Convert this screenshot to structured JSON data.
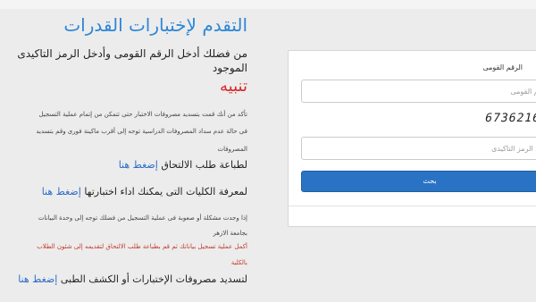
{
  "page": {
    "title": "التقدم لإختبارات القدرات",
    "enter_line1": "من فضلك أدخل الرقم القومى وأدخل الرمز التاكيدى",
    "enter_line2": "الموجود",
    "warning_title": "تنبيه",
    "note_line1": "تأكد من أنك قمت بتسديد مصروفات الاختبار حتى تتمكن من إتمام عملية التسجيل",
    "note_line2": "فى حالة عدم سداد المصروفات الدراسية توجه إلى أقرب ماكينة فورى وقم بتسديد",
    "note_line3": "المصروفات",
    "print_text": "لطباعة طلب الالتحاق",
    "colleges_text": "لمعرفة الكليات التى يمكنك اداء اختبارتها",
    "problem_line1": "إذا وجدت مشكلة أو صعوبة فى عملية التسجيل من فضلك توجه إلى وحدة البيانات",
    "problem_line2": "بجامعة الازهر",
    "red_line1": "أكمل عملية تسجيل بياناتك ثم قم بطباعة طلب الالتحاق لتقديمه إلى شئون الطلاب",
    "red_line2": "بالكلية",
    "pay_text": "لتسديد مصروفات الإختبارات أو الكشف الطبى",
    "click_here": "إضغط هنا"
  },
  "form": {
    "national_id_label": "الرقم القومى",
    "national_id_placeholder": "الرقم القومى",
    "captcha_code": "6736216",
    "captcha_placeholder": "أدخل الرمز التأكيدى",
    "search_button": "بحث"
  },
  "colors": {
    "title": "#2d86d6",
    "warning": "#d72b2b",
    "link": "#2d6cc7",
    "button": "#2a73c4"
  }
}
